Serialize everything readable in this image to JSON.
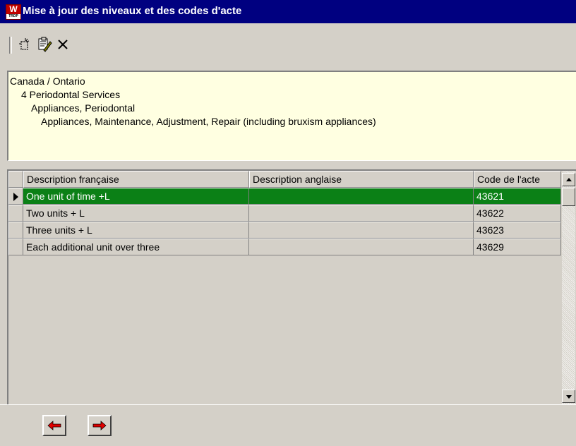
{
  "window": {
    "title": "Mise à jour des niveaux et des codes d'acte",
    "app_icon": {
      "letter": "W",
      "caption": "TRDP",
      "icon_name": "app-icon"
    }
  },
  "toolbar": {
    "buttons": [
      {
        "icon": "new-icon"
      },
      {
        "icon": "edit-icon"
      },
      {
        "icon": "delete-icon"
      }
    ]
  },
  "tree": {
    "lines": [
      "Canada / Ontario",
      "4 Periodontal Services",
      "Appliances, Periodontal",
      "Appliances, Maintenance, Adjustment, Repair (including bruxism appliances)"
    ]
  },
  "grid": {
    "columns": [
      "Description française",
      "Description anglaise",
      "Code de l'acte"
    ],
    "rows": [
      {
        "fr": "One unit of time +L",
        "en": "",
        "code": "43621",
        "selected": true
      },
      {
        "fr": "Two units + L",
        "en": "",
        "code": "43622",
        "selected": false
      },
      {
        "fr": "Three units + L",
        "en": "",
        "code": "43623",
        "selected": false
      },
      {
        "fr": "Each additional unit over three",
        "en": "",
        "code": "43629",
        "selected": false
      }
    ]
  },
  "navigation": {
    "buttons": [
      {
        "icon": "arrow-left-icon"
      },
      {
        "icon": "arrow-right-icon"
      }
    ]
  },
  "colors": {
    "titlebar": "#000080",
    "selection": "#0b8016",
    "info_panel": "#ffffe1",
    "nav_arrow": "#e00000"
  }
}
